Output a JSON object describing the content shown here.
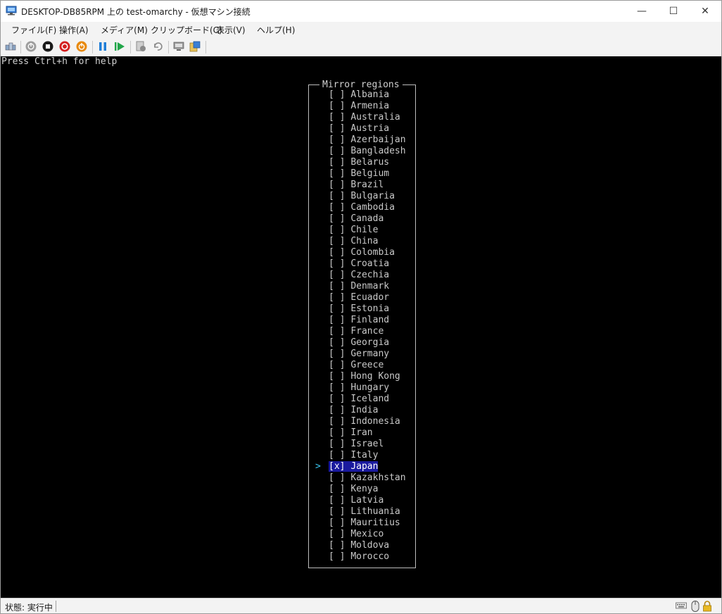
{
  "window": {
    "title": "DESKTOP-DB85RPM 上の test-omarchy - 仮想マシン接続",
    "minimize_glyph": "—",
    "maximize_glyph": "☐",
    "close_glyph": "✕"
  },
  "menu": {
    "items": [
      "ファイル(F)",
      "操作(A)",
      "メディア(M)",
      "クリップボード(C)",
      "表示(V)",
      "ヘルプ(H)"
    ]
  },
  "toolbar": {
    "icons": [
      "ctrl-alt-del-icon",
      "start-icon",
      "turn-off-icon",
      "shut-down-icon",
      "power-icon",
      "pause-icon",
      "resume-icon",
      "checkpoint-icon",
      "revert-icon",
      "enhanced-session-icon",
      "share-icon"
    ],
    "colors": {
      "gray": "#9e9e9e",
      "black": "#1a1a1a",
      "red": "#d42020",
      "orange": "#e88a10",
      "blue": "#1f7ed8",
      "green": "#22a64a"
    }
  },
  "console": {
    "help_line": "Press Ctrl+h for help",
    "dialog_title": "Mirror regions",
    "unchecked_mark": "[ ]",
    "checked_mark": "[x]",
    "cursor_glyph": ">",
    "regions": [
      {
        "name": "Albania",
        "checked": false
      },
      {
        "name": "Armenia",
        "checked": false
      },
      {
        "name": "Australia",
        "checked": false
      },
      {
        "name": "Austria",
        "checked": false
      },
      {
        "name": "Azerbaijan",
        "checked": false
      },
      {
        "name": "Bangladesh",
        "checked": false
      },
      {
        "name": "Belarus",
        "checked": false
      },
      {
        "name": "Belgium",
        "checked": false
      },
      {
        "name": "Brazil",
        "checked": false
      },
      {
        "name": "Bulgaria",
        "checked": false
      },
      {
        "name": "Cambodia",
        "checked": false
      },
      {
        "name": "Canada",
        "checked": false
      },
      {
        "name": "Chile",
        "checked": false
      },
      {
        "name": "China",
        "checked": false
      },
      {
        "name": "Colombia",
        "checked": false
      },
      {
        "name": "Croatia",
        "checked": false
      },
      {
        "name": "Czechia",
        "checked": false
      },
      {
        "name": "Denmark",
        "checked": false
      },
      {
        "name": "Ecuador",
        "checked": false
      },
      {
        "name": "Estonia",
        "checked": false
      },
      {
        "name": "Finland",
        "checked": false
      },
      {
        "name": "France",
        "checked": false
      },
      {
        "name": "Georgia",
        "checked": false
      },
      {
        "name": "Germany",
        "checked": false
      },
      {
        "name": "Greece",
        "checked": false
      },
      {
        "name": "Hong Kong",
        "checked": false
      },
      {
        "name": "Hungary",
        "checked": false
      },
      {
        "name": "Iceland",
        "checked": false
      },
      {
        "name": "India",
        "checked": false
      },
      {
        "name": "Indonesia",
        "checked": false
      },
      {
        "name": "Iran",
        "checked": false
      },
      {
        "name": "Israel",
        "checked": false
      },
      {
        "name": "Italy",
        "checked": false
      },
      {
        "name": "Japan",
        "checked": true,
        "focused": true
      },
      {
        "name": "Kazakhstan",
        "checked": false
      },
      {
        "name": "Kenya",
        "checked": false
      },
      {
        "name": "Latvia",
        "checked": false
      },
      {
        "name": "Lithuania",
        "checked": false
      },
      {
        "name": "Mauritius",
        "checked": false
      },
      {
        "name": "Mexico",
        "checked": false
      },
      {
        "name": "Moldova",
        "checked": false
      },
      {
        "name": "Morocco",
        "checked": false
      }
    ],
    "colors": {
      "background": "#000000",
      "text": "#c9c9c9",
      "highlight": "#1a1a9e",
      "cursor": "#3ac8f2"
    }
  },
  "statusbar": {
    "status": "状態: 実行中",
    "icons": [
      "keyboard-icon",
      "mouse-icon",
      "lock-icon"
    ]
  }
}
